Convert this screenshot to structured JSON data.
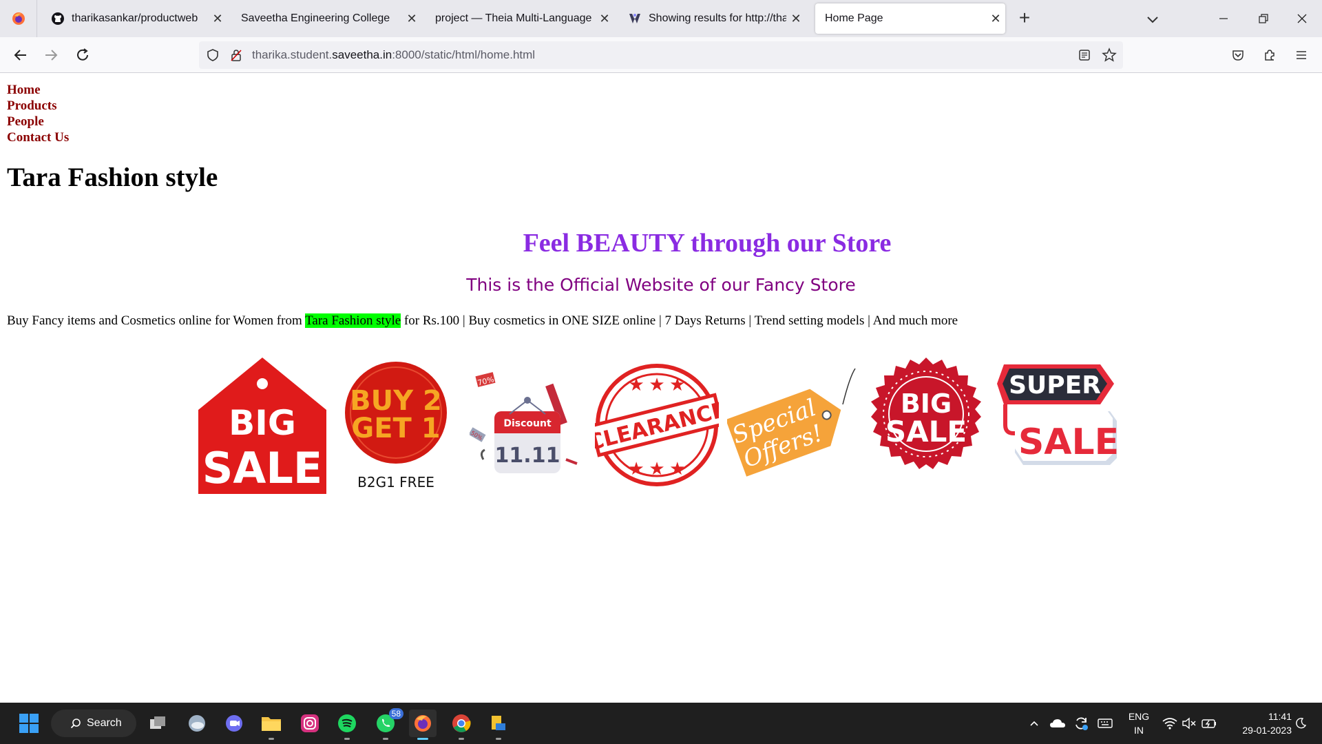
{
  "browser": {
    "tabs": [
      {
        "title": "tharikasankar/productweb",
        "icon": "github-icon",
        "active": false
      },
      {
        "title": "Saveetha Engineering College",
        "icon": "",
        "active": false
      },
      {
        "title": "project — Theia Multi-Language Ex",
        "icon": "",
        "active": false
      },
      {
        "title": "Showing results for http://tharik",
        "icon": "search-result-icon",
        "active": false
      },
      {
        "title": "Home Page",
        "icon": "",
        "active": true
      }
    ],
    "url_prefix": "tharika.student.",
    "url_domain": "saveetha.in",
    "url_suffix": ":8000/static/html/home.html"
  },
  "page": {
    "menu": [
      "Home",
      "Products",
      "People",
      "Contact Us"
    ],
    "site_title": "Tara Fashion style",
    "tagline": "Feel BEAUTY through our Store",
    "official": "This is the Official Website of our Fancy Store",
    "desc_before": "Buy Fancy items and Cosmetics online for Women from ",
    "desc_highlight": "Tara Fashion style",
    "desc_after": " for Rs.100 | Buy cosmetics in ONE SIZE online | 7 Days Returns | Trend setting models | And much more",
    "badges": {
      "big_sale_1": [
        "BIG",
        "SALE"
      ],
      "buy2get1": [
        "BUY 2",
        "GET 1",
        "B2G1 FREE"
      ],
      "discount": [
        "Discount",
        "11.11",
        "70%",
        "50%"
      ],
      "clearance": "CLEARANCE",
      "special": [
        "Special",
        "Offers!"
      ],
      "big_sale_2": [
        "BIG",
        "SALE"
      ],
      "super_sale": [
        "SUPER",
        "SALE"
      ]
    }
  },
  "taskbar": {
    "search_label": "Search",
    "whatsapp_badge": "58",
    "lang_line1": "ENG",
    "lang_line2": "IN",
    "time": "11:41",
    "date": "29-01-2023"
  },
  "colors": {
    "menu_link": "#8b0000",
    "tagline": "#8a2be2",
    "official": "#800080",
    "highlight": "#00ff00",
    "sale_red": "#d7191e"
  }
}
